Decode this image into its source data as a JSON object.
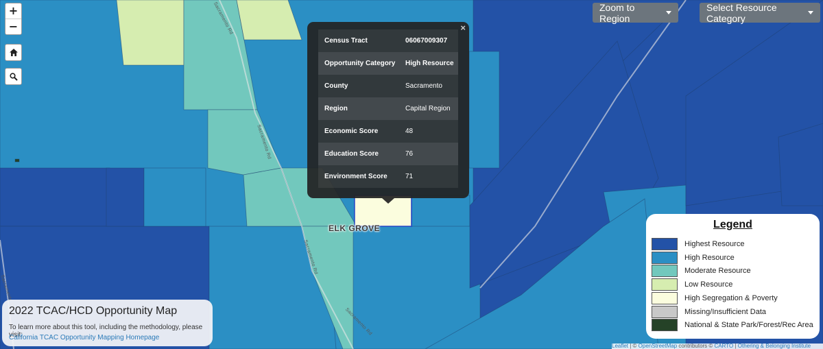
{
  "map": {
    "colors": {
      "highest": "#2352a7",
      "high": "#2b8fc4",
      "moderate": "#72c8bd",
      "low": "#d6edb0",
      "segregation": "#fbfdde",
      "missing": "#c8c8c8",
      "park": "#254227"
    },
    "city_label": "ELK GROVE",
    "road_labels": [
      "Sacramento Rd",
      "Sacramento Rd",
      "Sacramento Rd",
      "Sacramento Rd",
      "Sacramento Rd"
    ]
  },
  "controls": {
    "zoom_in": "+",
    "zoom_out": "−",
    "home_icon": "home-icon",
    "search_icon": "search-icon"
  },
  "toolbar": {
    "zoom_region_label": "Zoom to Region",
    "resource_category_label": "Select Resource Category"
  },
  "popup": {
    "close": "×",
    "rows": [
      {
        "label": "Census Tract",
        "value": "06067009307"
      },
      {
        "label": "Opportunity Category",
        "value": "High Resource"
      },
      {
        "label": "County",
        "value": "Sacramento"
      },
      {
        "label": "Region",
        "value": "Capital Region"
      },
      {
        "label": "Economic Score",
        "value": "48"
      },
      {
        "label": "Education Score",
        "value": "76"
      },
      {
        "label": "Environment Score",
        "value": "71"
      }
    ]
  },
  "legend": {
    "title": "Legend",
    "items": [
      {
        "label": "Highest Resource",
        "color": "#2352a7"
      },
      {
        "label": "High Resource",
        "color": "#2b8fc4"
      },
      {
        "label": "Moderate Resource",
        "color": "#72c8bd"
      },
      {
        "label": "Low Resource",
        "color": "#d6edb0"
      },
      {
        "label": "High Segregation & Poverty",
        "color": "#fbfdde"
      },
      {
        "label": "Missing/Insufficient Data",
        "color": "#c8c8c8"
      },
      {
        "label": "National & State Park/Forest/Rec Area",
        "color": "#254227"
      }
    ]
  },
  "info": {
    "title": "2022 TCAC/HCD Opportunity Map",
    "description": "To learn more about this tool, including the methodology, please visit:",
    "link": "California TCAC Opportunity Mapping Homepage"
  },
  "attribution": {
    "leaflet": "Leaflet",
    "sep": " | © ",
    "osm": "OpenStreetMap",
    "mid": " contributors © ",
    "carto": "CARTO",
    "sep2": " | ",
    "othering": "Othering & Belonging Institute"
  }
}
